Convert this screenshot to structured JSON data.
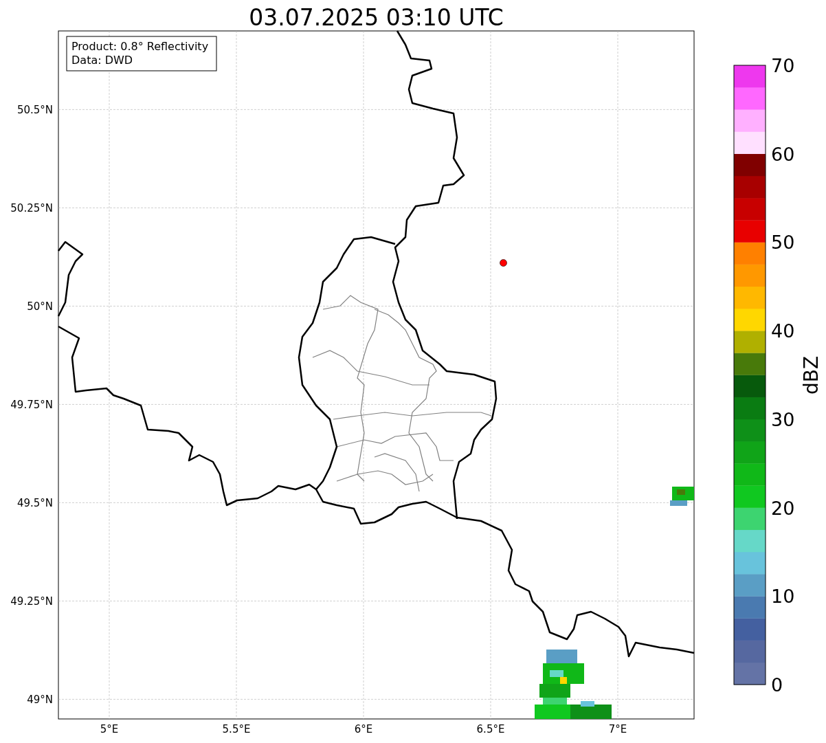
{
  "title": "03.07.2025 03:10 UTC",
  "info_box": [
    "Product: 0.8° Reflectivity",
    "Data: DWD"
  ],
  "map": {
    "chart_data": {
      "type": "scatter",
      "xlim": [
        4.8,
        7.3
      ],
      "ylim": [
        48.95,
        50.7
      ],
      "xticks": [
        {
          "value": 5,
          "label": "5°E"
        },
        {
          "value": 5.5,
          "label": "5.5°E"
        },
        {
          "value": 6,
          "label": "6°E"
        },
        {
          "value": 6.5,
          "label": "6.5°E"
        },
        {
          "value": 7,
          "label": "7°E"
        }
      ],
      "yticks": [
        {
          "value": 49,
          "label": "49°N"
        },
        {
          "value": 49.25,
          "label": "49.25°N"
        },
        {
          "value": 49.5,
          "label": "49.5°N"
        },
        {
          "value": 49.75,
          "label": "49.75°N"
        },
        {
          "value": 50,
          "label": "50°N"
        },
        {
          "value": 50.25,
          "label": "50.25°N"
        },
        {
          "value": 50.5,
          "label": "50.5°N"
        }
      ],
      "grid": true,
      "series": [
        {
          "color": "#ff0000",
          "x": [
            6.55
          ],
          "values": [
            50.11
          ]
        }
      ]
    }
  },
  "colorbar": {
    "label": "dBZ",
    "ticks": [
      "70",
      "60",
      "50",
      "40",
      "30",
      "20",
      "10",
      "0"
    ]
  }
}
